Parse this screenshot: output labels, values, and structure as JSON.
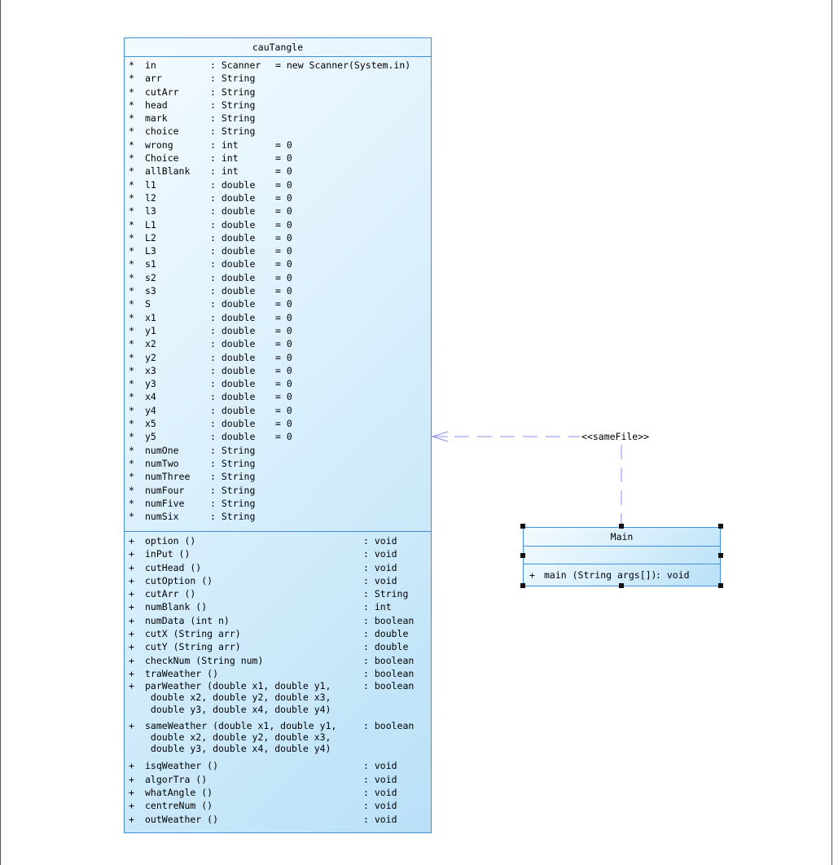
{
  "classes": {
    "cauTangle": {
      "name": "cauTangle",
      "attributes": [
        {
          "vis": "*",
          "name": "in",
          "type": ": Scanner",
          "init": "= new Scanner(System.in)"
        },
        {
          "vis": "*",
          "name": "arr",
          "type": ": String",
          "init": ""
        },
        {
          "vis": "*",
          "name": "cutArr",
          "type": ": String",
          "init": ""
        },
        {
          "vis": "*",
          "name": "head",
          "type": ": String",
          "init": ""
        },
        {
          "vis": "*",
          "name": "mark",
          "type": ": String",
          "init": ""
        },
        {
          "vis": "*",
          "name": "choice",
          "type": ": String",
          "init": ""
        },
        {
          "vis": "*",
          "name": "wrong",
          "type": ": int",
          "init": "= 0"
        },
        {
          "vis": "*",
          "name": "Choice",
          "type": ": int",
          "init": "= 0"
        },
        {
          "vis": "*",
          "name": "allBlank",
          "type": ": int",
          "init": "= 0"
        },
        {
          "vis": "*",
          "name": "l1",
          "type": ": double",
          "init": "= 0"
        },
        {
          "vis": "*",
          "name": "l2",
          "type": ": double",
          "init": "= 0"
        },
        {
          "vis": "*",
          "name": "l3",
          "type": ": double",
          "init": "= 0"
        },
        {
          "vis": "*",
          "name": "L1",
          "type": ": double",
          "init": "= 0"
        },
        {
          "vis": "*",
          "name": "L2",
          "type": ": double",
          "init": "= 0"
        },
        {
          "vis": "*",
          "name": "L3",
          "type": ": double",
          "init": "= 0"
        },
        {
          "vis": "*",
          "name": "s1",
          "type": ": double",
          "init": "= 0"
        },
        {
          "vis": "*",
          "name": "s2",
          "type": ": double",
          "init": "= 0"
        },
        {
          "vis": "*",
          "name": "s3",
          "type": ": double",
          "init": "= 0"
        },
        {
          "vis": "*",
          "name": "S",
          "type": ": double",
          "init": "= 0"
        },
        {
          "vis": "*",
          "name": "x1",
          "type": ": double",
          "init": "= 0"
        },
        {
          "vis": "*",
          "name": "y1",
          "type": ": double",
          "init": "= 0"
        },
        {
          "vis": "*",
          "name": "x2",
          "type": ": double",
          "init": "= 0"
        },
        {
          "vis": "*",
          "name": "y2",
          "type": ": double",
          "init": "= 0"
        },
        {
          "vis": "*",
          "name": "x3",
          "type": ": double",
          "init": "= 0"
        },
        {
          "vis": "*",
          "name": "y3",
          "type": ": double",
          "init": "= 0"
        },
        {
          "vis": "*",
          "name": "x4",
          "type": ": double",
          "init": "= 0"
        },
        {
          "vis": "*",
          "name": "y4",
          "type": ": double",
          "init": "= 0"
        },
        {
          "vis": "*",
          "name": "x5",
          "type": ": double",
          "init": "= 0"
        },
        {
          "vis": "*",
          "name": "y5",
          "type": ": double",
          "init": "= 0"
        },
        {
          "vis": "*",
          "name": "numOne",
          "type": ": String",
          "init": ""
        },
        {
          "vis": "*",
          "name": "numTwo",
          "type": ": String",
          "init": ""
        },
        {
          "vis": "*",
          "name": "numThree",
          "type": ": String",
          "init": ""
        },
        {
          "vis": "*",
          "name": "numFour",
          "type": ": String",
          "init": ""
        },
        {
          "vis": "*",
          "name": "numFive",
          "type": ": String",
          "init": ""
        },
        {
          "vis": "*",
          "name": "numSix",
          "type": ": String",
          "init": ""
        }
      ],
      "operations": [
        {
          "vis": "+",
          "sig": [
            "option ()"
          ],
          "ret": ": void"
        },
        {
          "vis": "+",
          "sig": [
            "inPut ()"
          ],
          "ret": ": void"
        },
        {
          "vis": "+",
          "sig": [
            "cutHead ()"
          ],
          "ret": ": void"
        },
        {
          "vis": "+",
          "sig": [
            "cutOption ()"
          ],
          "ret": ": void"
        },
        {
          "vis": "+",
          "sig": [
            "cutArr ()"
          ],
          "ret": ": String"
        },
        {
          "vis": "+",
          "sig": [
            "numBlank ()"
          ],
          "ret": ": int"
        },
        {
          "vis": "+",
          "sig": [
            "numData (int n)"
          ],
          "ret": ": boolean"
        },
        {
          "vis": "+",
          "sig": [
            "cutX (String arr)"
          ],
          "ret": ": double"
        },
        {
          "vis": "+",
          "sig": [
            "cutY (String arr)"
          ],
          "ret": ": double"
        },
        {
          "vis": "+",
          "sig": [
            "checkNum (String num)"
          ],
          "ret": ": boolean"
        },
        {
          "vis": "+",
          "sig": [
            "traWeather ()"
          ],
          "ret": ": boolean"
        },
        {
          "vis": "+",
          "sig": [
            "parWeather (double x1, double y1,",
            " double x2, double y2, double x3,",
            " double y3, double x4, double y4)"
          ],
          "ret": ": boolean"
        },
        {
          "vis": "+",
          "sig": [
            "sameWeather (double x1, double y1,",
            " double x2, double y2, double x3,",
            " double y3, double x4, double y4)"
          ],
          "ret": ": boolean"
        },
        {
          "vis": "+",
          "sig": [
            "isqWeather ()"
          ],
          "ret": ": void"
        },
        {
          "vis": "+",
          "sig": [
            "algorTra ()"
          ],
          "ret": ": void"
        },
        {
          "vis": "+",
          "sig": [
            "whatAngle ()"
          ],
          "ret": ": void"
        },
        {
          "vis": "+",
          "sig": [
            "centreNum ()"
          ],
          "ret": ": void"
        },
        {
          "vis": "+",
          "sig": [
            "outWeather ()"
          ],
          "ret": ": void"
        }
      ]
    },
    "Main": {
      "name": "Main",
      "operations": [
        {
          "vis": "+",
          "sig": "main (String args[])",
          "ret": ": void"
        }
      ]
    }
  },
  "relationship": {
    "stereotype": "<<sameFile>>",
    "from": "Main",
    "to": "cauTangle",
    "style": "dashed dependency"
  },
  "colors": {
    "class_border": "#3f8fd8",
    "connector": "#8a8ff0",
    "handle": "#111111"
  }
}
